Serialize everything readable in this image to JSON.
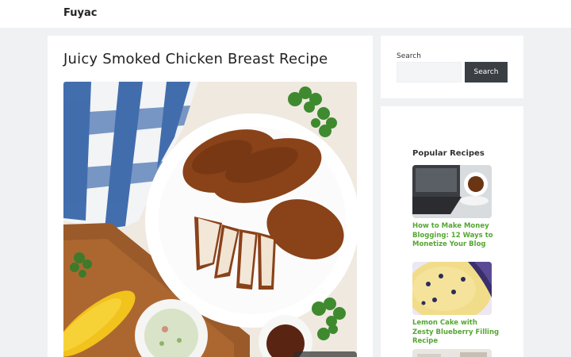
{
  "site": {
    "brand": "Fuyac"
  },
  "post": {
    "title": "Juicy Smoked Chicken Breast Recipe"
  },
  "search": {
    "label": "Search",
    "placeholder": "",
    "button_label": "Search"
  },
  "sidebar": {
    "popular_title": "Popular Recipes",
    "recipes": [
      {
        "title": "How to Make Money Blogging: 12 Ways to Monetize Your Blog"
      },
      {
        "title": "Lemon Cake with Zesty Blueberry Filling Recipe"
      }
    ]
  },
  "colors": {
    "link_green": "#55a632",
    "button_dark": "#3a3f44",
    "page_bg": "#f0f1f3"
  }
}
